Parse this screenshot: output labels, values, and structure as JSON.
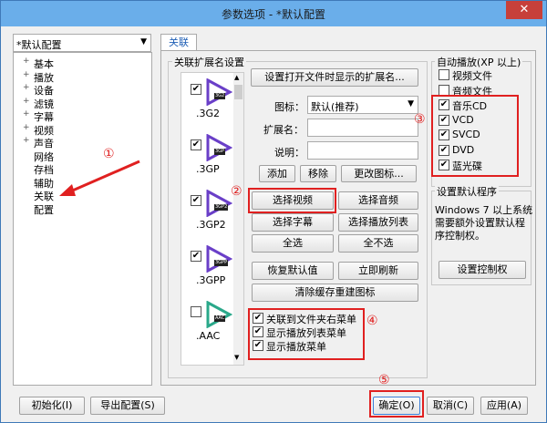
{
  "window": {
    "title": "参数选项 - *默认配置",
    "close": "✕"
  },
  "profile_select": {
    "value": "*默认配置"
  },
  "tree": [
    "基本",
    "播放",
    "设备",
    "滤镜",
    "字幕",
    "视频",
    "声音",
    "网络",
    "存档",
    "辅助",
    "关联",
    "配置"
  ],
  "tree_expand": [
    "+",
    "+",
    "+",
    "+",
    "+",
    "+",
    "+"
  ],
  "tab": {
    "label": "关联"
  },
  "ext_group": {
    "label": "关联扩展名设置"
  },
  "ext_items": [
    {
      "ext": ".3G2",
      "badge": "3G2",
      "checked": true,
      "color": "#6a3fc8"
    },
    {
      "ext": ".3GP",
      "badge": "3GP",
      "checked": true,
      "color": "#6a3fc8"
    },
    {
      "ext": ".3GP2",
      "badge": "3GP2",
      "checked": true,
      "color": "#6a3fc8"
    },
    {
      "ext": ".3GPP",
      "badge": "3GPP",
      "checked": true,
      "color": "#6a3fc8"
    },
    {
      "ext": ".AAC",
      "badge": "AAC",
      "checked": false,
      "color": "#2aa88a"
    }
  ],
  "set_open_ext_button": "设置打开文件时显示的扩展名...",
  "icon_label": "图标：",
  "icon_value": "默认(推荐)",
  "ext_name_label": "扩展名：",
  "desc_label": "说明：",
  "add_button": "添加",
  "remove_button": "移除",
  "change_icon_button": "更改图标...",
  "select_video": "选择视频",
  "select_audio": "选择音频",
  "select_subtitle": "选择字幕",
  "select_playlist": "选择播放列表",
  "select_all": "全选",
  "select_none": "全不选",
  "restore_default": "恢复默认值",
  "refresh_now": "立即刷新",
  "clear_cache": "清除缓存重建图标",
  "context_options": [
    {
      "label": "关联到文件夹右菜单",
      "checked": true
    },
    {
      "label": "显示播放列表菜单",
      "checked": true
    },
    {
      "label": "显示播放菜单",
      "checked": true
    }
  ],
  "autoplay_group": {
    "label": "自动播放(XP 以上)"
  },
  "autoplay_items": [
    {
      "label": "视频文件",
      "checked": false
    },
    {
      "label": "音频文件",
      "checked": false
    },
    {
      "label": "音乐CD",
      "checked": true
    },
    {
      "label": "VCD",
      "checked": true
    },
    {
      "label": "SVCD",
      "checked": true
    },
    {
      "label": "DVD",
      "checked": true
    },
    {
      "label": "蓝光碟",
      "checked": true
    }
  ],
  "default_group": {
    "label": "设置默认程序"
  },
  "default_desc": [
    "Windows 7 以上系统",
    "需要额外设置默认程",
    "序控制权。"
  ],
  "set_control_button": "设置控制权",
  "footer": {
    "init": "初始化(I)",
    "export": "导出配置(S)",
    "ok": "确定(O)",
    "cancel": "取消(C)",
    "apply": "应用(A)"
  },
  "annotations": [
    "①",
    "②",
    "③",
    "④",
    "⑤"
  ],
  "colors": {
    "annotation": "#e02020",
    "titlebar": "#6aaeea",
    "close": "#c7403a"
  }
}
